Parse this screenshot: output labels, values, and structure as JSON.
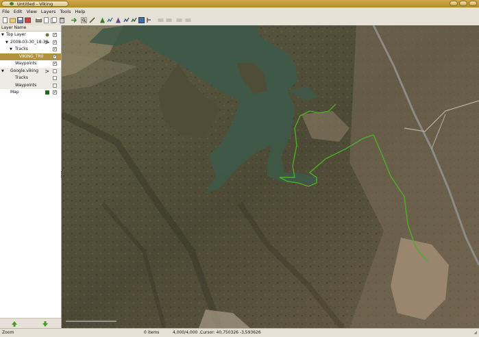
{
  "window": {
    "title": "Untitled - Viking"
  },
  "menu": [
    "File",
    "Edit",
    "View",
    "Layers",
    "Tools",
    "Help"
  ],
  "toolbar": {
    "icons": [
      "new-icon",
      "open-icon",
      "save-icon",
      "print-icon",
      "properties-icon",
      "cut-icon",
      "copy-icon",
      "paste-icon",
      "delete-icon",
      "go-back-icon",
      "pan-icon",
      "ruler-icon",
      "create-waypoint-icon",
      "create-track-icon",
      "edit-waypoint-icon",
      "edit-track-icon",
      "map-download-icon",
      "dem-icon",
      "undo-icon",
      "redo-icon",
      "zoom-out-icon",
      "zoom-in-icon"
    ]
  },
  "sidebar": {
    "header": "Layer Name",
    "layers": [
      {
        "label": "Top Layer",
        "checked": true
      },
      {
        "label": "2008-03-30_18-38-",
        "checked": true
      },
      {
        "label": "Tracks",
        "checked": true
      },
      {
        "label": "VIKING_TR0",
        "checked": true,
        "selected": true
      },
      {
        "label": "Waypoints",
        "checked": true
      },
      {
        "label": "Google.viking",
        "checked": false
      },
      {
        "label": "Tracks",
        "checked": false
      },
      {
        "label": "Waypoints",
        "checked": false
      },
      {
        "label": "Map",
        "checked": true
      }
    ]
  },
  "status": {
    "tool": "Zoom",
    "items": "0 items",
    "zoom": "4,000/4,000 ...",
    "cursor": "Cursor: 40,750326 -3,593626"
  },
  "colors": {
    "accent": "#b3913f",
    "track": "#4caf2a",
    "map_base": "#57553f",
    "water": "#3e5848"
  }
}
